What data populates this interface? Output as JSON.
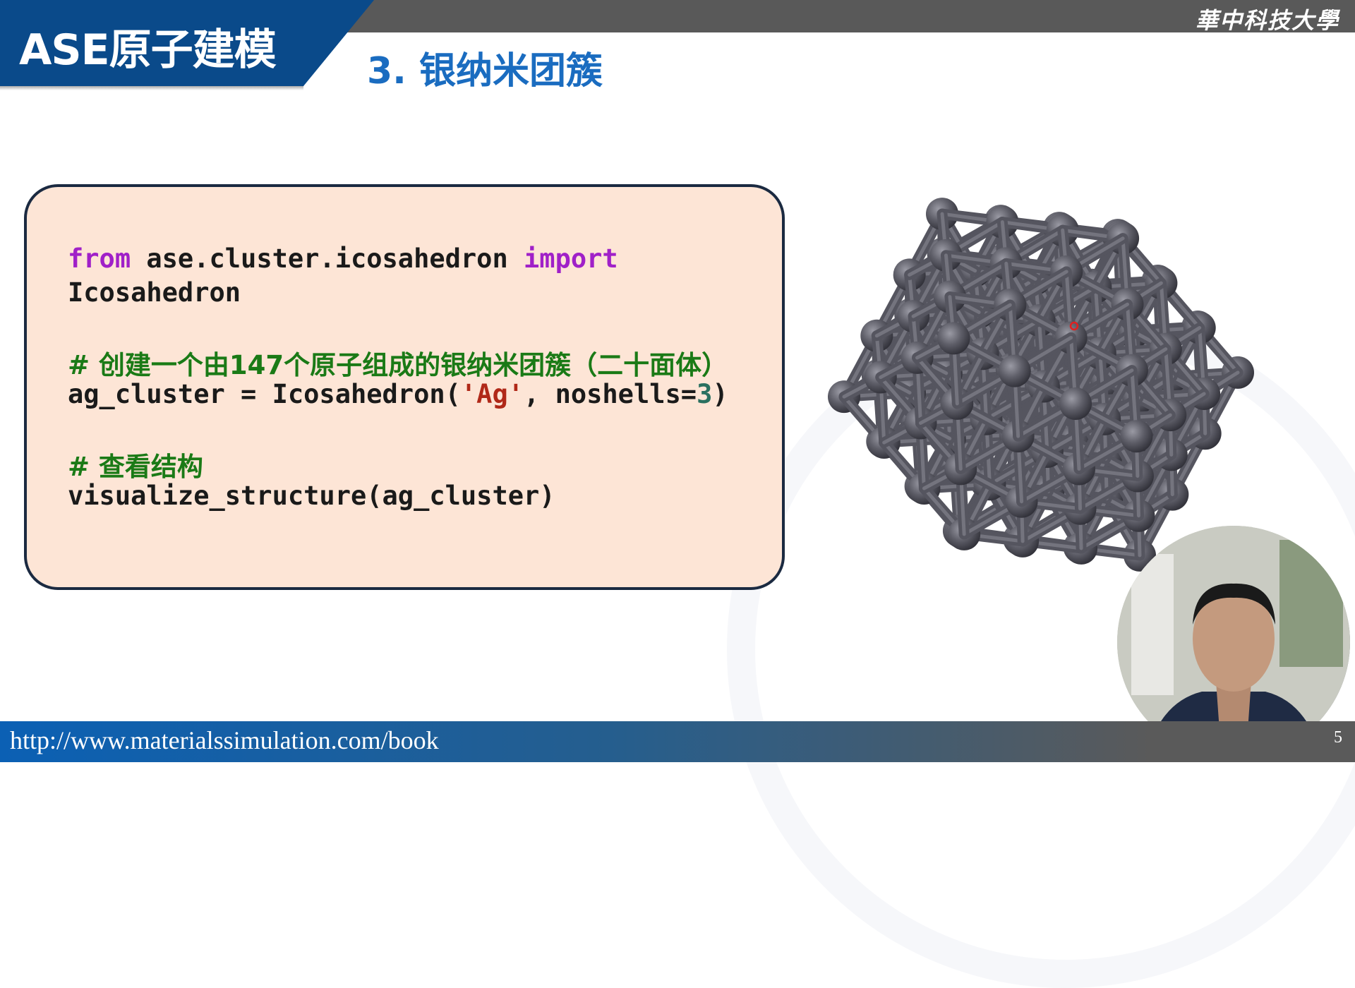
{
  "header": {
    "course_title": "ASE原子建模",
    "section_title": "3. 银纳米团簇",
    "university_logo": "華中科技大學"
  },
  "code": {
    "line1_kw_from": "from",
    "line1_module": " ase.cluster.icosahedron ",
    "line1_kw_import": "import",
    "line2": "Icosahedron",
    "comment1_hash": "# ",
    "comment1_text": "创建一个由147个原子组成的银纳米团簇（二十面体）",
    "line3_a": "ag_cluster = Icosahedron(",
    "line3_str": "'Ag'",
    "line3_b": ", noshells=",
    "line3_num": "3",
    "line3_c": ")",
    "comment2_hash": "# ",
    "comment2_text": "查看结构",
    "line4": "visualize_structure(ag_cluster)"
  },
  "colors": {
    "keyword": "#a020c8",
    "string": "#b02818",
    "number": "#2a7060",
    "comment": "#1a7a16",
    "brand_blue": "#0a4a8a",
    "atom": "#5c5c66"
  },
  "footer": {
    "url": "http://www.materialssimulation.com/book",
    "page_number": "5"
  }
}
